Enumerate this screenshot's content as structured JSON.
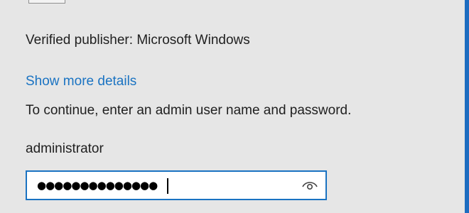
{
  "dialog": {
    "publisher_text": "Verified publisher: Microsoft Windows",
    "details_link": "Show more details",
    "instructions": "To continue, enter an admin user name and password.",
    "username": "administrator",
    "password_masked": "●●●●●●●●●●●●●●",
    "reveal_icon": "eye-icon",
    "accent_color": "#1a73c2",
    "frame_border_color": "#1d6cc0"
  }
}
